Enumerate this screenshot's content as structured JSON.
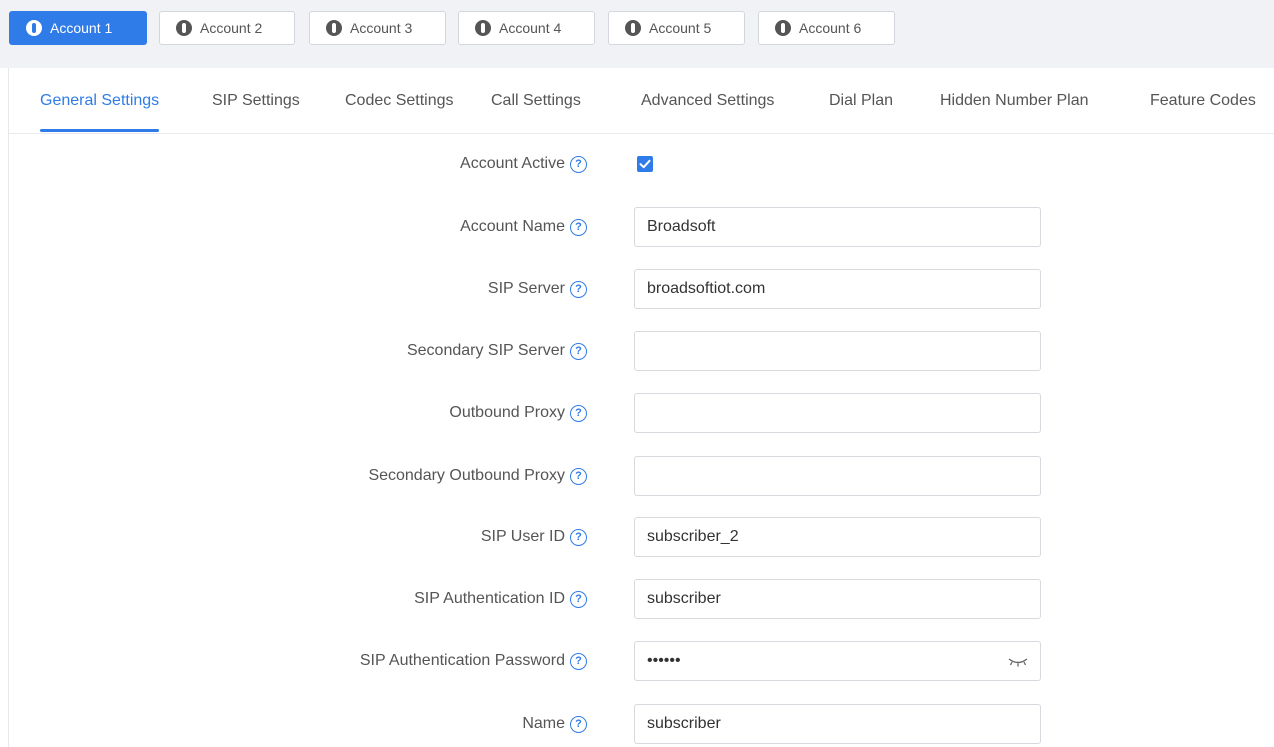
{
  "accounts": [
    {
      "label": "Account 1",
      "active": true
    },
    {
      "label": "Account 2",
      "active": false
    },
    {
      "label": "Account 3",
      "active": false
    },
    {
      "label": "Account 4",
      "active": false
    },
    {
      "label": "Account 5",
      "active": false
    },
    {
      "label": "Account 6",
      "active": false
    }
  ],
  "tabs": [
    {
      "label": "General Settings",
      "active": true
    },
    {
      "label": "SIP Settings",
      "active": false
    },
    {
      "label": "Codec Settings",
      "active": false
    },
    {
      "label": "Call Settings",
      "active": false
    },
    {
      "label": "Advanced Settings",
      "active": false
    },
    {
      "label": "Dial Plan",
      "active": false
    },
    {
      "label": "Hidden Number Plan",
      "active": false
    },
    {
      "label": "Feature Codes",
      "active": false
    }
  ],
  "form": {
    "account_active": {
      "label": "Account Active",
      "checked": true
    },
    "account_name": {
      "label": "Account Name",
      "value": "Broadsoft"
    },
    "sip_server": {
      "label": "SIP Server",
      "value": "broadsoftiot.com"
    },
    "secondary_sip_server": {
      "label": "Secondary SIP Server",
      "value": ""
    },
    "outbound_proxy": {
      "label": "Outbound Proxy",
      "value": ""
    },
    "secondary_outbound_proxy": {
      "label": "Secondary Outbound Proxy",
      "value": ""
    },
    "sip_user_id": {
      "label": "SIP User ID",
      "value": "subscriber_2"
    },
    "sip_auth_id": {
      "label": "SIP Authentication ID",
      "value": "subscriber"
    },
    "sip_auth_password": {
      "label": "SIP Authentication Password",
      "value": "••••••",
      "toggle_icon": "eye-closed-icon"
    },
    "name": {
      "label": "Name",
      "value": "subscriber"
    }
  },
  "icons": {
    "help": "?",
    "account": "account-icon"
  },
  "colors": {
    "accent": "#2f7ce8",
    "text": "#555555",
    "bar_bg": "#f1f2f5",
    "border": "#d6d9de"
  }
}
